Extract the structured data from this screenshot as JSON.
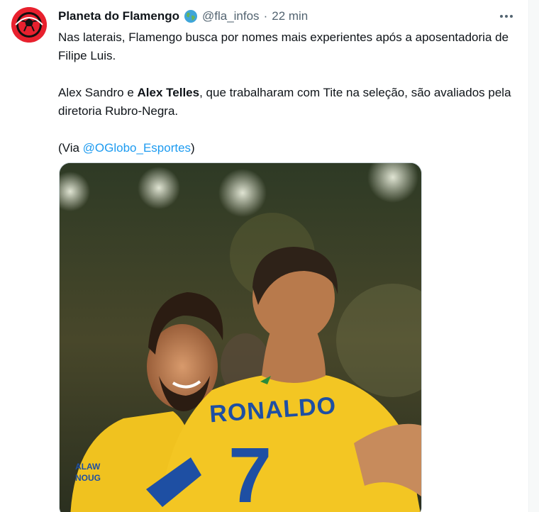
{
  "author": {
    "display_name": "Planeta do Flamengo",
    "handle": "@fla_infos",
    "separator": "·",
    "time": "22 min"
  },
  "tweet": {
    "p1": "Nas laterais, Flamengo busca por nomes mais experientes após a aposentadoria de Filipe Luis.",
    "p2_before": "Alex Sandro e ",
    "p2_bold": "Alex Telles",
    "p2_after": ", que trabalharam com Tite na seleção, são avaliados pela diretoria Rubro-Negra.",
    "p3_open": "(Via ",
    "p3_mention": "@OGlobo_Esportes",
    "p3_close": ")"
  },
  "media": {
    "jersey_name": "RONALDO",
    "jersey_number": "7",
    "sleeve_text_1": "ALAW",
    "sleeve_text_2": "NOUG"
  },
  "icons": {
    "more": "more-horizontal-icon",
    "globe": "globe-icon",
    "avatar": "flamengo-ball-logo"
  },
  "colors": {
    "mention": "#1d9bf0",
    "secondary_text": "#536471",
    "jersey_yellow": "#f3c623",
    "jersey_blue": "#1e4fa3"
  }
}
